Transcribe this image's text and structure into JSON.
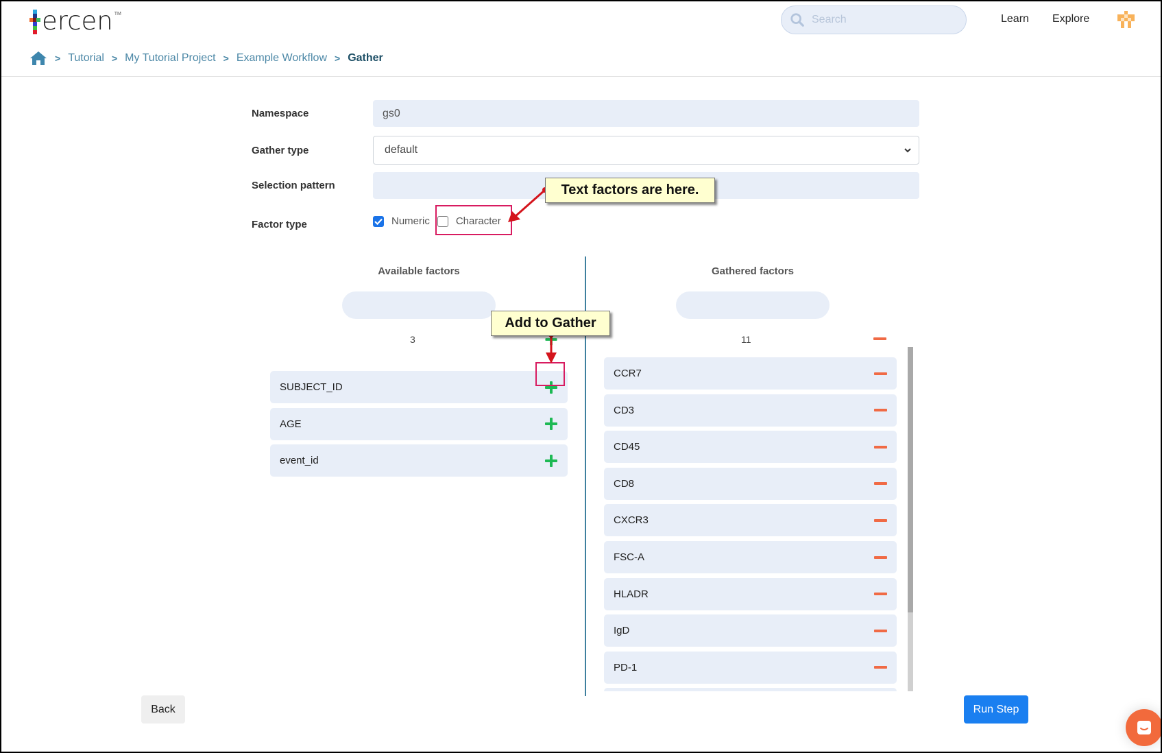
{
  "header": {
    "logo_text": "ercen",
    "logo_tm": "TM",
    "search_placeholder": "Search",
    "nav": [
      {
        "label": "Learn"
      },
      {
        "label": "Explore"
      }
    ],
    "colors": {
      "avatar": "#f8b25a"
    }
  },
  "breadcrumb": {
    "separator": ">",
    "items": [
      {
        "label": "Tutorial"
      },
      {
        "label": "My Tutorial Project"
      },
      {
        "label": "Example Workflow"
      },
      {
        "label": "Gather"
      }
    ]
  },
  "form": {
    "namespace": {
      "label": "Namespace",
      "value": "gs0"
    },
    "gather_type": {
      "label": "Gather type",
      "value": "default"
    },
    "selection_pattern": {
      "label": "Selection pattern",
      "value": ""
    },
    "factor_type": {
      "label": "Factor type",
      "options": [
        {
          "label": "Numeric",
          "checked": true
        },
        {
          "label": "Character",
          "checked": false
        }
      ]
    }
  },
  "annotations": {
    "character_callout": "Text factors are here.",
    "add_callout": "Add to Gather"
  },
  "available": {
    "title": "Available factors",
    "count": "3",
    "items": [
      {
        "label": "SUBJECT_ID"
      },
      {
        "label": "AGE"
      },
      {
        "label": "event_id"
      }
    ]
  },
  "gathered": {
    "title": "Gathered factors",
    "count": "11",
    "items": [
      {
        "label": "CCR7"
      },
      {
        "label": "CD3"
      },
      {
        "label": "CD45"
      },
      {
        "label": "CD8"
      },
      {
        "label": "CXCR3"
      },
      {
        "label": "FSC-A"
      },
      {
        "label": "HLADR"
      },
      {
        "label": "IgD"
      },
      {
        "label": "PD-1"
      },
      {
        "label": ""
      }
    ],
    "scroll_visible_fraction": 0.77
  },
  "footer": {
    "back_label": "Back",
    "run_label": "Run Step"
  },
  "colors": {
    "add": "#1db954",
    "remove": "#f06a45",
    "primary": "#1a7ff0",
    "highlight": "#d81b60",
    "chat": "#f26a3c"
  }
}
